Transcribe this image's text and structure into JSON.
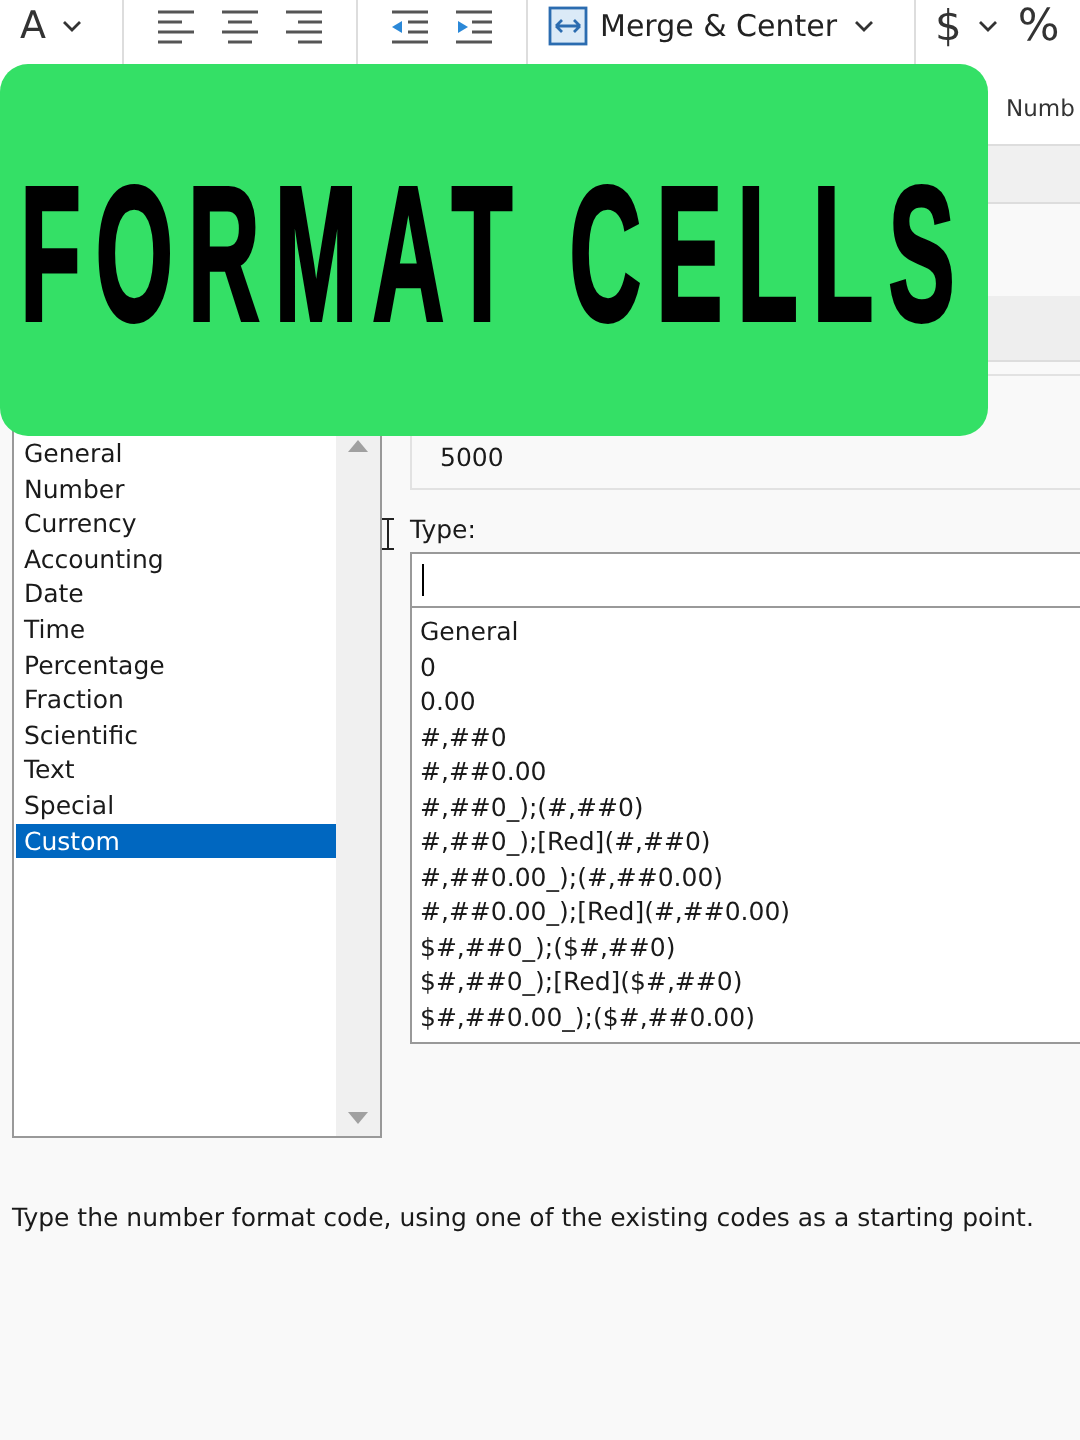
{
  "ribbon": {
    "font_color_label": "A",
    "merge_button": "Merge & Center",
    "currency_symbol": "$",
    "percent_symbol": "%",
    "group_label": "Numb"
  },
  "banner": {
    "title": "FORMAT CELLS"
  },
  "dialog": {
    "category": {
      "items": [
        {
          "label": "General",
          "selected": false
        },
        {
          "label": "Number",
          "selected": false
        },
        {
          "label": "Currency",
          "selected": false
        },
        {
          "label": "Accounting",
          "selected": false
        },
        {
          "label": "Date",
          "selected": false
        },
        {
          "label": "Time",
          "selected": false
        },
        {
          "label": "Percentage",
          "selected": false
        },
        {
          "label": "Fraction",
          "selected": false
        },
        {
          "label": "Scientific",
          "selected": false
        },
        {
          "label": "Text",
          "selected": false
        },
        {
          "label": "Special",
          "selected": false
        },
        {
          "label": "Custom",
          "selected": true
        }
      ]
    },
    "sample": {
      "value": "5000"
    },
    "type": {
      "label": "Type:",
      "codes": [
        "General",
        "0",
        "0.00",
        "#,##0",
        "#,##0.00",
        "#,##0_);(#,##0)",
        "#,##0_);[Red](#,##0)",
        "#,##0.00_);(#,##0.00)",
        "#,##0.00_);[Red](#,##0.00)",
        "$#,##0_);($#,##0)",
        "$#,##0_);[Red]($#,##0)",
        "$#,##0.00_);($#,##0.00)"
      ]
    },
    "description": "Type the number format code, using one of the existing codes as a starting point."
  }
}
